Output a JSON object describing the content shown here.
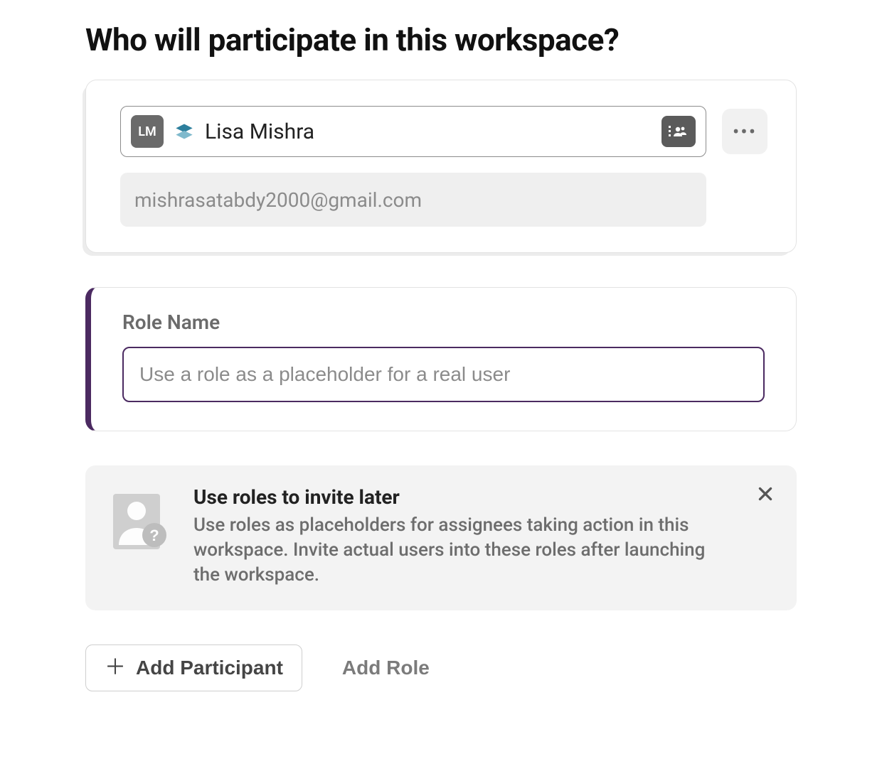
{
  "heading": "Who will participate in this workspace?",
  "participant": {
    "initials": "LM",
    "name": "Lisa Mishra",
    "email": "mishrasatabdy2000@gmail.com"
  },
  "role": {
    "label": "Role Name",
    "placeholder": "Use a role as a placeholder for a real user"
  },
  "info": {
    "title": "Use roles to invite later",
    "description": "Use roles as placeholders for assignees taking action in this workspace. Invite actual users into these roles after launching the workspace."
  },
  "actions": {
    "add_participant": "Add Participant",
    "add_role": "Add Role"
  },
  "colors": {
    "accent": "#4b2a61"
  }
}
